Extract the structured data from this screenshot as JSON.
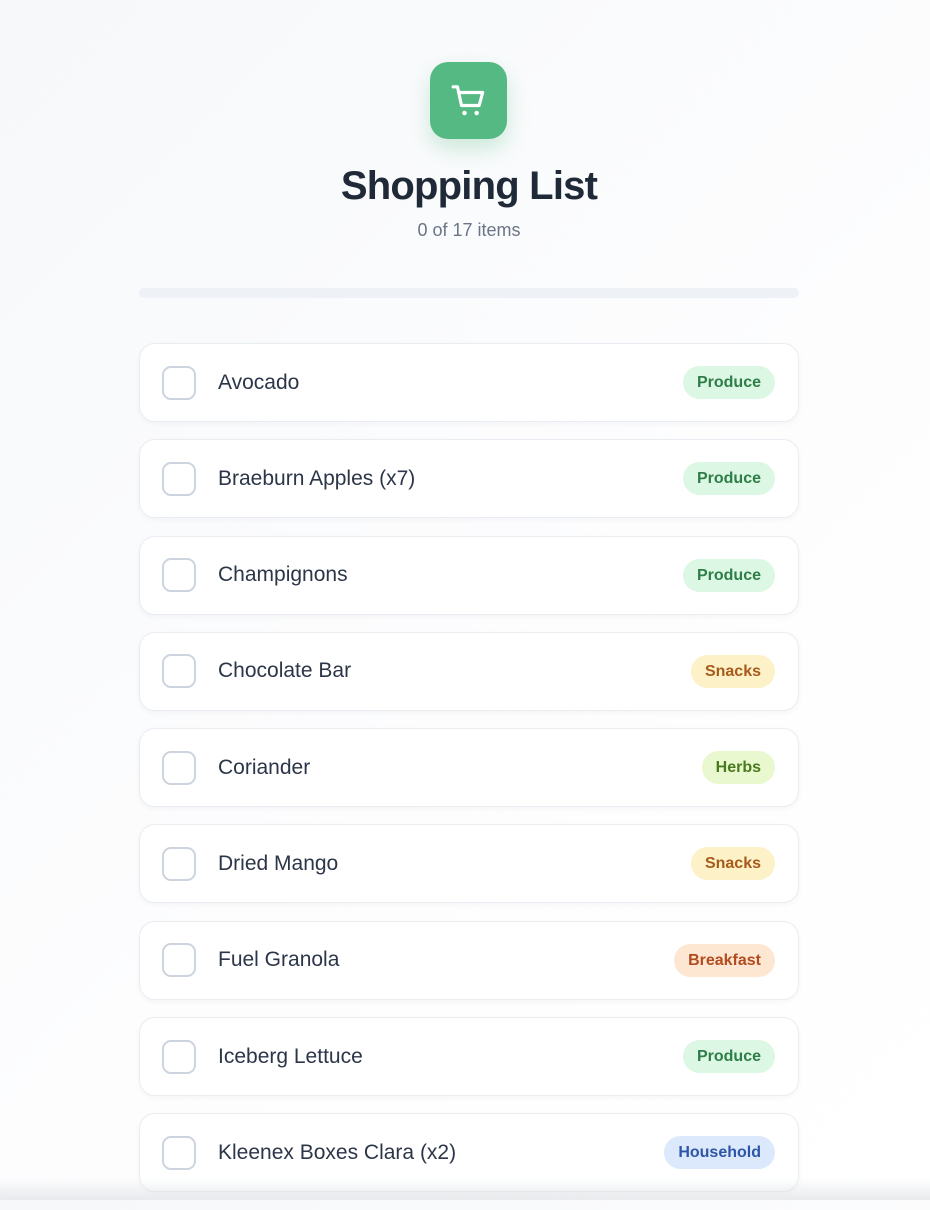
{
  "header": {
    "icon": "shopping-cart-icon",
    "title": "Shopping List",
    "subtitle": "0 of 17 items",
    "progress": 0
  },
  "colors": {
    "accent": "#55b984"
  },
  "items": [
    {
      "name": "Avocado",
      "category": "Produce",
      "checked": false
    },
    {
      "name": "Braeburn Apples (x7)",
      "category": "Produce",
      "checked": false
    },
    {
      "name": "Champignons",
      "category": "Produce",
      "checked": false
    },
    {
      "name": "Chocolate Bar",
      "category": "Snacks",
      "checked": false
    },
    {
      "name": "Coriander",
      "category": "Herbs",
      "checked": false
    },
    {
      "name": "Dried Mango",
      "category": "Snacks",
      "checked": false
    },
    {
      "name": "Fuel Granola",
      "category": "Breakfast",
      "checked": false
    },
    {
      "name": "Iceberg Lettuce",
      "category": "Produce",
      "checked": false
    },
    {
      "name": "Kleenex Boxes Clara (x2)",
      "category": "Household",
      "checked": false
    }
  ]
}
